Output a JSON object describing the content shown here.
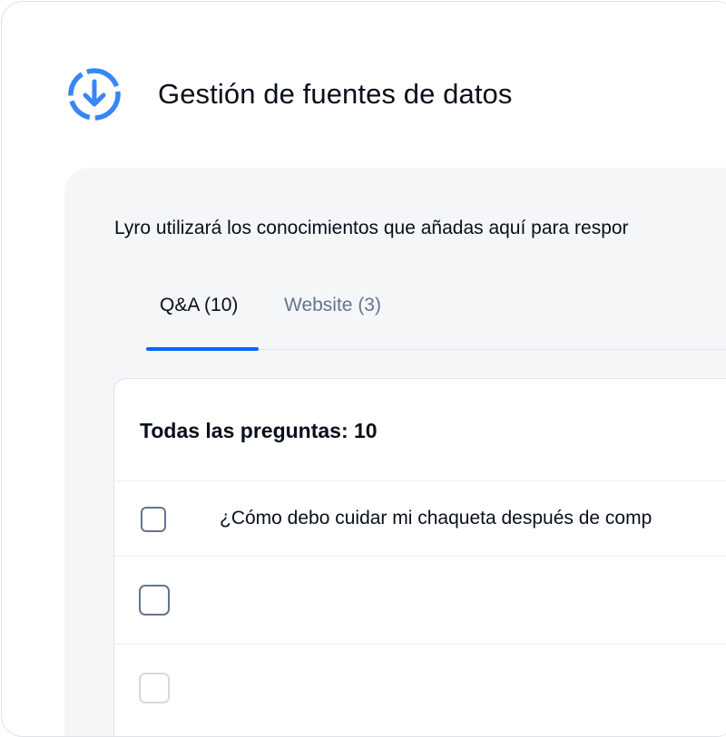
{
  "header": {
    "title": "Gestión de fuentes de datos",
    "icon": "download-circle-icon",
    "accent_color": "#3886f6"
  },
  "panel": {
    "intro_text": "Lyro utilizará los conocimientos que añadas aquí para respor"
  },
  "tabs": [
    {
      "label": "Q&A (10)",
      "active": true
    },
    {
      "label": "Website (3)",
      "active": false
    }
  ],
  "tab_underline_color": "#0566ff",
  "questions": {
    "header": "Todas las preguntas: 10",
    "rows": [
      {
        "text": "¿Cómo debo cuidar mi chaqueta después de comp"
      },
      {
        "text": ""
      },
      {
        "text": ""
      }
    ]
  }
}
